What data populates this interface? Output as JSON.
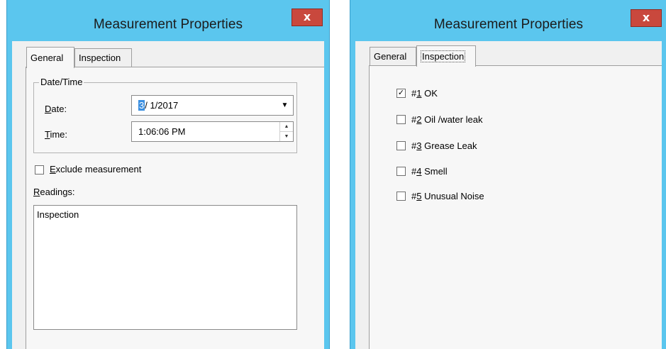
{
  "dialogs": [
    {
      "title": "Measurement Properties",
      "close_glyph": "x",
      "tabs": [
        {
          "label": "General",
          "selected": true
        },
        {
          "label": "Inspection",
          "selected": false
        }
      ],
      "general": {
        "group_label": "Date/Time",
        "date_label_key": "D",
        "date_label_rest": "ate:",
        "date_value_selected": "3",
        "date_value_rest": "/ 1/2017",
        "time_label_key": "T",
        "time_label_rest": "ime:",
        "time_value": "1:06:06 PM",
        "exclude_checked": false,
        "exclude_label_key": "E",
        "exclude_label_rest": "xclude measurement",
        "readings_label_key": "R",
        "readings_label_rest": "eadings:",
        "readings_value": "Inspection"
      }
    },
    {
      "title": "Measurement Properties",
      "close_glyph": "x",
      "tabs": [
        {
          "label": "General",
          "selected": false
        },
        {
          "label": "Inspection",
          "selected": true
        }
      ],
      "inspection": {
        "items": [
          {
            "prefix": "#",
            "key": "1",
            "label": " OK",
            "checked": true
          },
          {
            "prefix": "#",
            "key": "2",
            "label": " Oil /water leak",
            "checked": false
          },
          {
            "prefix": "#",
            "key": "3",
            "label": " Grease Leak",
            "checked": false
          },
          {
            "prefix": "#",
            "key": "4",
            "label": " Smell",
            "checked": false
          },
          {
            "prefix": "#",
            "key": "5",
            "label": " Unusual Noise",
            "checked": false
          }
        ]
      }
    }
  ],
  "colors": {
    "titlebar": "#5bc6ee",
    "close_button": "#c9483d",
    "selection": "#3b8fe0"
  },
  "icons": {
    "close": "close-icon",
    "dropdown": "chevron-down-icon",
    "spin_up": "spin-up-icon",
    "spin_down": "spin-down-icon",
    "check": "checkmark-icon"
  }
}
